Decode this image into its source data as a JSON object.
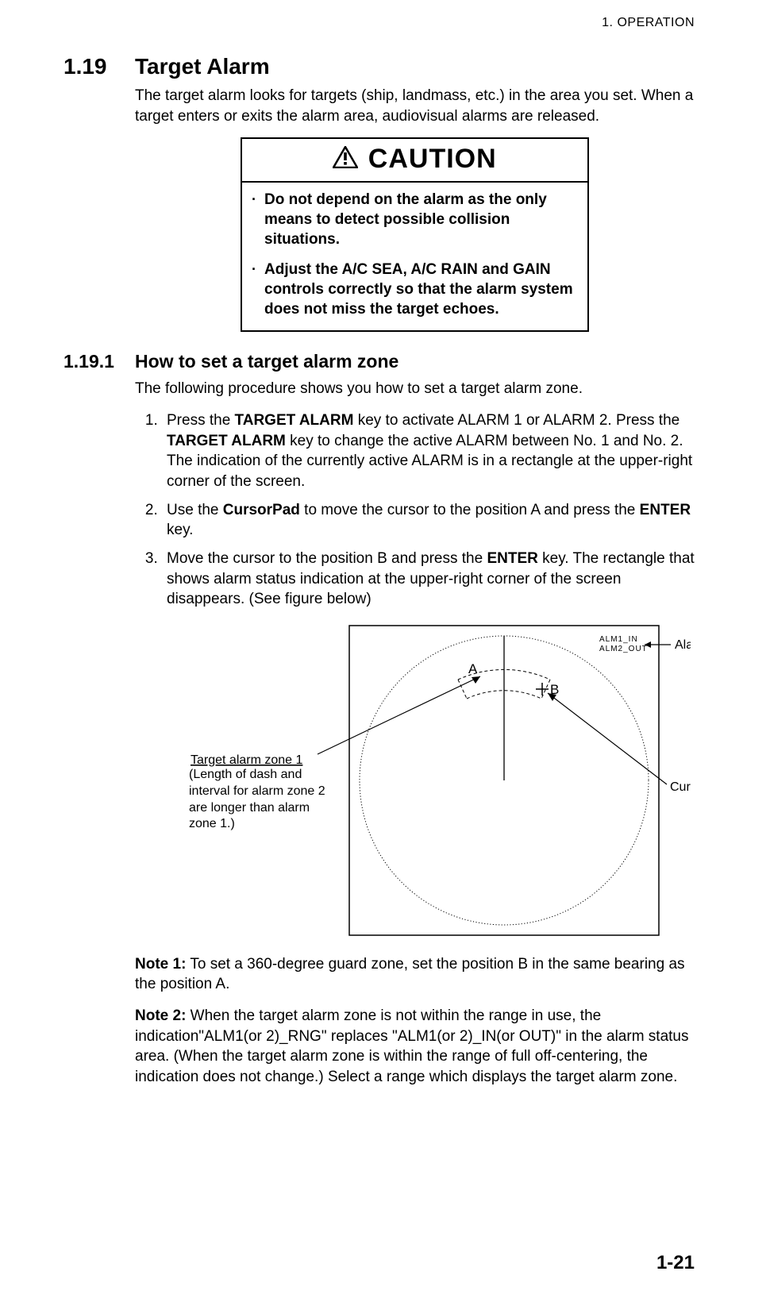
{
  "running_header": "1.  OPERATION",
  "section": {
    "number": "1.19",
    "title": "Target Alarm",
    "intro": "The target alarm looks for targets (ship, landmass, etc.) in the area you set. When a target enters or exits the alarm area, audiovisual alarms are released."
  },
  "caution": {
    "label": "CAUTION",
    "items": [
      "Do not depend on the alarm as the only means to detect possible collision situations.",
      "Adjust the A/C SEA, A/C RAIN and GAIN controls correctly so that the alarm system does not miss the target echoes."
    ]
  },
  "subsection": {
    "number": "1.19.1",
    "title": "How to set a target alarm zone",
    "intro": "The following procedure shows you how to set a target alarm zone."
  },
  "steps": {
    "s1_a": "Press the ",
    "s1_k1": "TARGET ALARM",
    "s1_b": " key to activate ALARM 1 or ALARM 2. Press the ",
    "s1_k2": "TARGET ALARM",
    "s1_c": " key to change the active ALARM between No. 1 and No. 2. The indication of the currently active ALARM is in a rectangle at the upper-right corner of the screen.",
    "s2_a": "Use the ",
    "s2_k1": "CursorPad",
    "s2_b": " to move the cursor to the position A and press the ",
    "s2_k2": "ENTER",
    "s2_c": " key.",
    "s3_a": "Move the cursor to the position B and press the ",
    "s3_k1": "ENTER",
    "s3_b": " key. The rectangle that shows alarm status indication at the upper-right corner of the screen disappears. (See figure below)"
  },
  "figure": {
    "alarm_status_1": "ALM1_IN",
    "alarm_status_2": "ALM2_OUT",
    "label_alarm_status": "Alarm status",
    "label_cursor": "Cursor",
    "label_A": "A",
    "label_B": "B",
    "label_zone_title": "Target alarm zone 1",
    "label_zone_desc": "(Length of dash and interval for alarm zone 2 are longer than alarm zone 1.)"
  },
  "notes": {
    "n1_label": "Note 1:",
    "n1_text": " To set a 360-degree guard zone, set the position B in the same bearing as the position A.",
    "n2_label": "Note 2:",
    "n2_text": " When the target alarm zone is not within the range in use, the indication\"ALM1(or 2)_RNG\" replaces \"ALM1(or 2)_IN(or OUT)\" in the alarm status area. (When the target alarm zone is within the range of full off-centering, the indication does not change.) Select a range which displays the target alarm zone."
  },
  "page_number": "1-21",
  "chart_data": {
    "type": "diagram",
    "description": "Radar display illustrating setting of target alarm zone",
    "elements": {
      "outer_circle": "radar range ring",
      "heading_line": "vertical line from center upward",
      "point_A": "start position of alarm zone (left of heading line)",
      "point_B": "end position of alarm zone / cursor (right of heading line, marked +)",
      "alarm_zone_arc": "dashed arc segment between A and B near top of circle (Target alarm zone 1)",
      "status_box_labels": [
        "ALM1_IN",
        "ALM2_OUT"
      ],
      "callouts": [
        "Alarm status",
        "Cursor",
        "Target alarm zone 1"
      ]
    }
  }
}
